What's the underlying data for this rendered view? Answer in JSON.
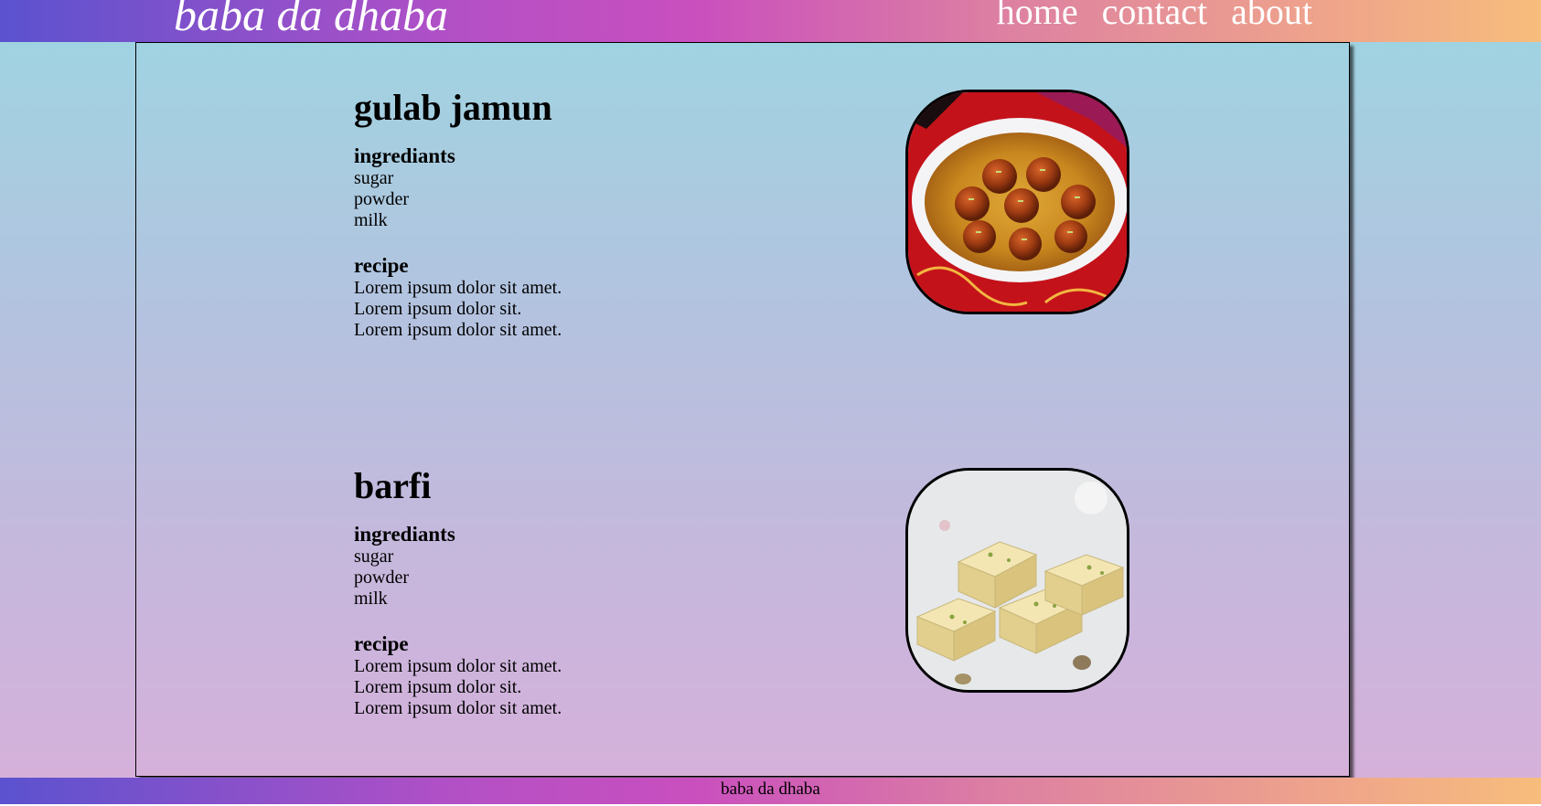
{
  "header": {
    "brand": "baba da dhaba",
    "nav": [
      "home",
      "contact",
      "about"
    ]
  },
  "recipes": [
    {
      "title": "gulab jamun",
      "ingredients_heading": "ingrediants",
      "ingredients": [
        "sugar",
        "powder",
        "milk"
      ],
      "recipe_heading": "recipe",
      "recipe_lines": [
        "Lorem ipsum dolor sit amet.",
        "Lorem ipsum dolor sit.",
        "Lorem ipsum dolor sit amet."
      ],
      "image_icon": "gulab-jamun-photo"
    },
    {
      "title": "barfi",
      "ingredients_heading": "ingrediants",
      "ingredients": [
        "sugar",
        "powder",
        "milk"
      ],
      "recipe_heading": "recipe",
      "recipe_lines": [
        "Lorem ipsum dolor sit amet.",
        "Lorem ipsum dolor sit.",
        "Lorem ipsum dolor sit amet."
      ],
      "image_icon": "barfi-photo"
    }
  ],
  "footer": {
    "text": "baba da dhaba"
  },
  "colors": {
    "header_gradient_start": "#5b52cf",
    "header_gradient_mid": "#c94fbe",
    "header_gradient_end": "#f7bd7c",
    "page_bg_top": "#9dd6e2",
    "page_bg_bottom": "#d7b0da"
  }
}
